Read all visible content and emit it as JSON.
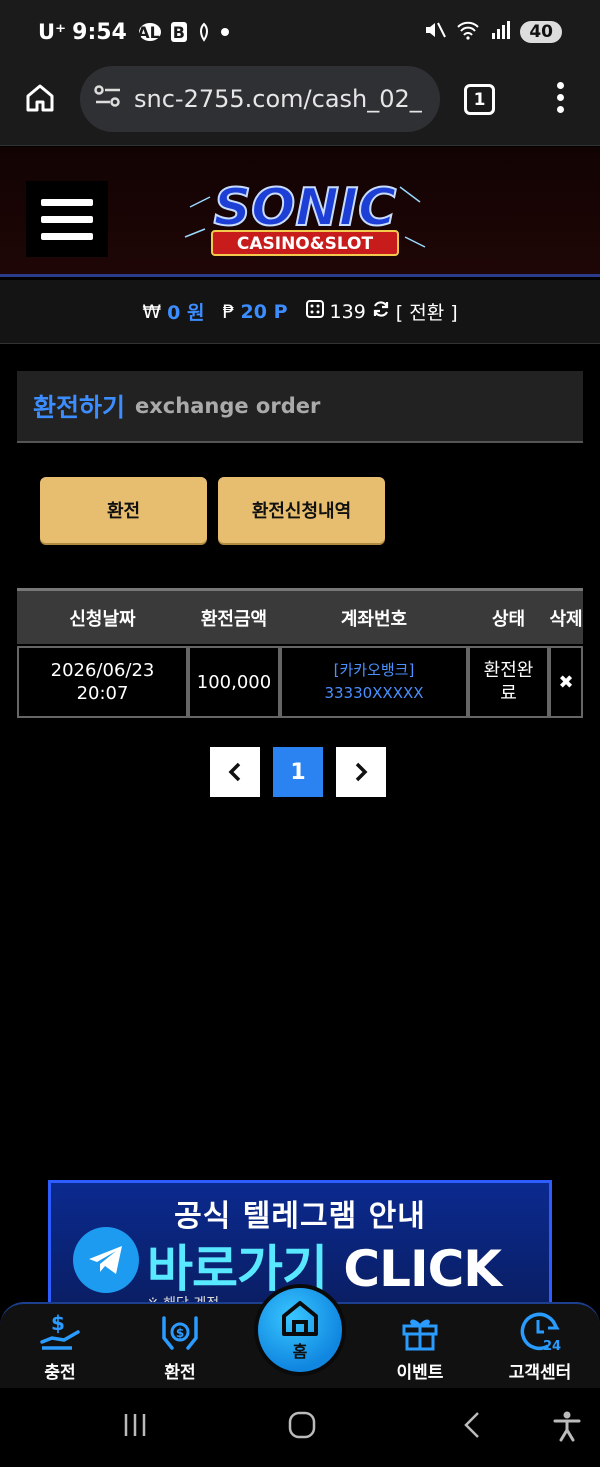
{
  "status_bar": {
    "carrier": "U⁺",
    "time": "9:54",
    "talk_icon_text": "TALK",
    "b_icon_text": "B",
    "battery": "40"
  },
  "browser": {
    "url": "snc-2755.com/cash_02_",
    "tab_count": "1"
  },
  "site": {
    "logo_title": "SONIC",
    "logo_sub": "CASINO&SLOT"
  },
  "balance": {
    "won_symbol": "₩",
    "won_value": "0 원",
    "point_symbol": "₱",
    "point_value": "20 P",
    "chip_value": "139",
    "convert_label": "[ 전환 ]"
  },
  "section": {
    "title_ko": "환전하기",
    "title_en": "exchange order"
  },
  "tabs": [
    {
      "label": "환전"
    },
    {
      "label": "환전신청내역"
    }
  ],
  "table": {
    "headers": [
      "신청날짜",
      "환전금액",
      "계좌번호",
      "상태",
      "삭제"
    ],
    "rows": [
      {
        "date": "2026/06/23",
        "time": "20:07",
        "amount": "100,000",
        "bank": "[카카오뱅크]",
        "account": "33330XXXXX",
        "status_1": "환전완",
        "status_2": "료",
        "delete": "✖"
      }
    ]
  },
  "pagination": {
    "prev": "‹",
    "current": "1",
    "next": "›"
  },
  "telegram_banner": {
    "line1": "공식 텔레그램 안내",
    "line2_a": "바로가기",
    "line2_b": " CLICK",
    "line3": "※ 해당 계정 "
  },
  "bottom_nav": [
    {
      "label": "충전",
      "icon": "deposit-icon"
    },
    {
      "label": "환전",
      "icon": "withdraw-icon"
    },
    {
      "label": "홈",
      "icon": "home-icon"
    },
    {
      "label": "이벤트",
      "icon": "gift-icon"
    },
    {
      "label": "고객센터",
      "icon": "support-24-icon"
    }
  ],
  "colors": {
    "accent_blue": "#3c8dff",
    "tab_gold": "#e7bd6f",
    "page_active": "#2a83f0"
  }
}
